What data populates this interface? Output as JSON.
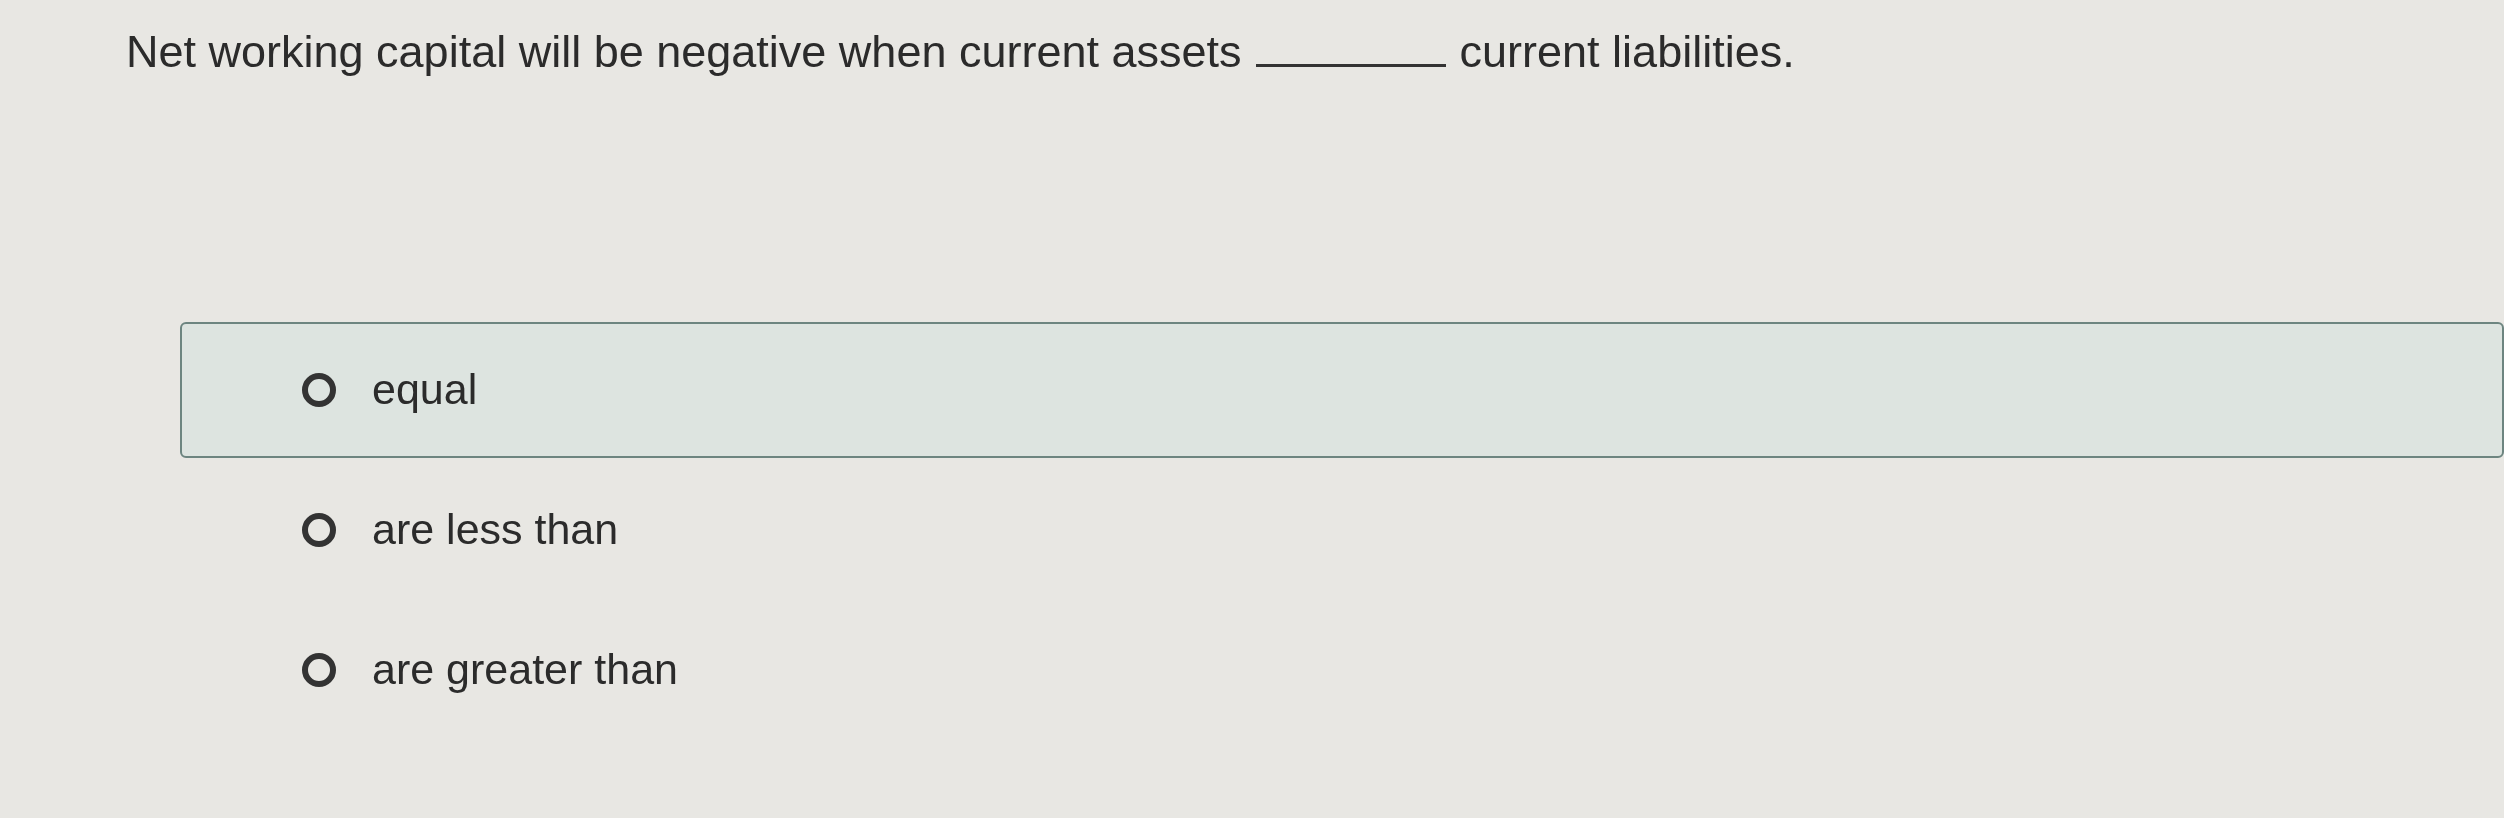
{
  "question": {
    "text_before": "Net working capital will be negative when current assets",
    "text_after": "current liabilities."
  },
  "options": [
    {
      "label": "equal",
      "selected": false,
      "highlighted": true
    },
    {
      "label": "are less than",
      "selected": false,
      "highlighted": false
    },
    {
      "label": "are greater than",
      "selected": false,
      "highlighted": false
    }
  ]
}
